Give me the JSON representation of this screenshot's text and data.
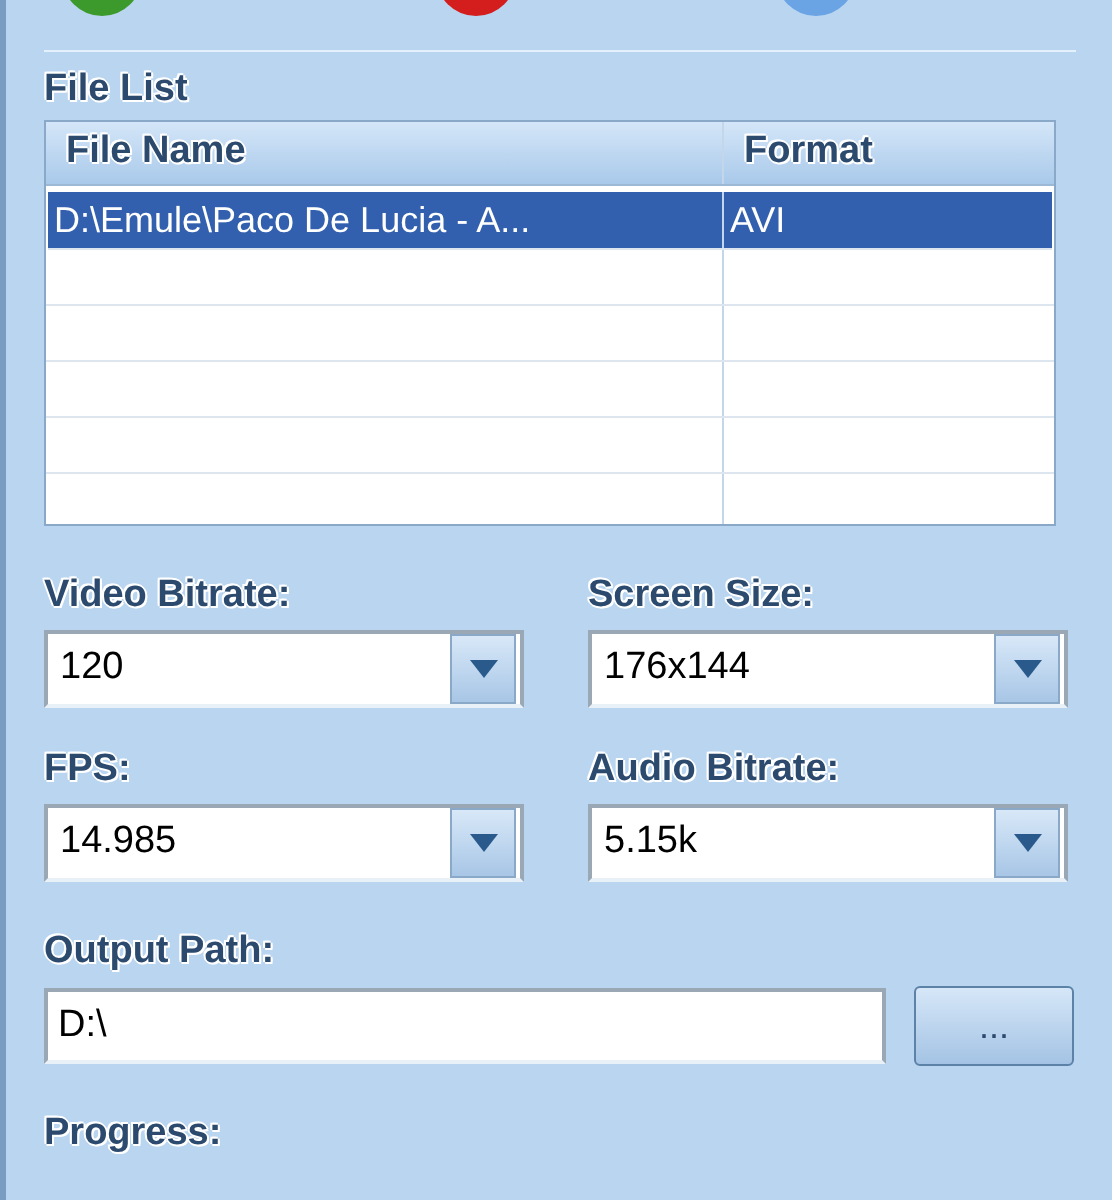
{
  "file_list": {
    "title": "File List",
    "columns": [
      "File Name",
      "Format"
    ],
    "rows": [
      {
        "cells": [
          "D:\\Emule\\Paco De Lucia - A...",
          "AVI"
        ],
        "selected": true
      }
    ]
  },
  "settings": [
    {
      "label": "Video Bitrate:",
      "value": "120"
    },
    {
      "label": "Screen Size:",
      "value": "176x144"
    },
    {
      "label": "FPS:",
      "value": "14.985"
    },
    {
      "label": "Audio Bitrate:",
      "value": "5.15k"
    }
  ],
  "output_path": {
    "label": "Output Path:",
    "value": "D:\\",
    "browse_button": "..."
  },
  "progress": {
    "label": "Progress:"
  }
}
